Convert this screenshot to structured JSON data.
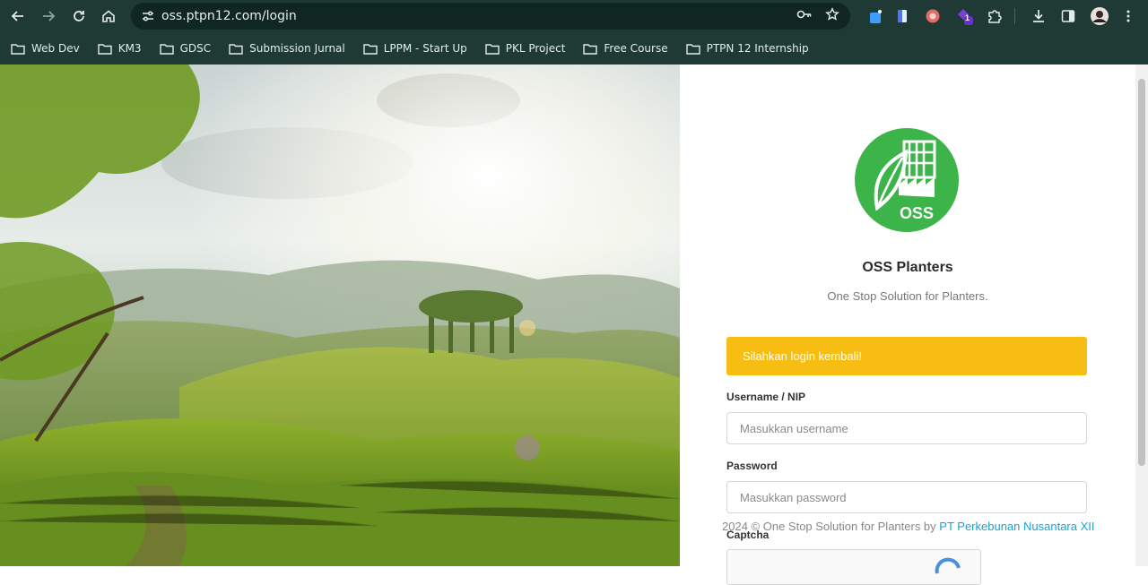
{
  "browser": {
    "url": "oss.ptpn12.com/login",
    "bookmarks": [
      {
        "label": "Web Dev"
      },
      {
        "label": "KM3"
      },
      {
        "label": "GDSC"
      },
      {
        "label": "Submission Jurnal"
      },
      {
        "label": "LPPM - Start Up"
      },
      {
        "label": "PKL Project"
      },
      {
        "label": "Free Course"
      },
      {
        "label": "PTPN 12 Internship"
      }
    ],
    "extension_badge": "1"
  },
  "login": {
    "logo_text": "OSS",
    "title": "OSS Planters",
    "subtitle": "One Stop Solution for Planters.",
    "alert": "Silahkan login kembali!",
    "username_label": "Username / NIP",
    "username_placeholder": "Masukkan username",
    "password_label": "Password",
    "password_placeholder": "Masukkan password",
    "captcha_label": "Captcha",
    "footer_text": "2024 © One Stop Solution for Planters by",
    "footer_link": "PT Perkebunan Nusantara XII"
  },
  "colors": {
    "chrome": "#1f3a34",
    "brand_green": "#3cb44a",
    "alert": "#f7bd12",
    "link": "#18a2d4"
  }
}
